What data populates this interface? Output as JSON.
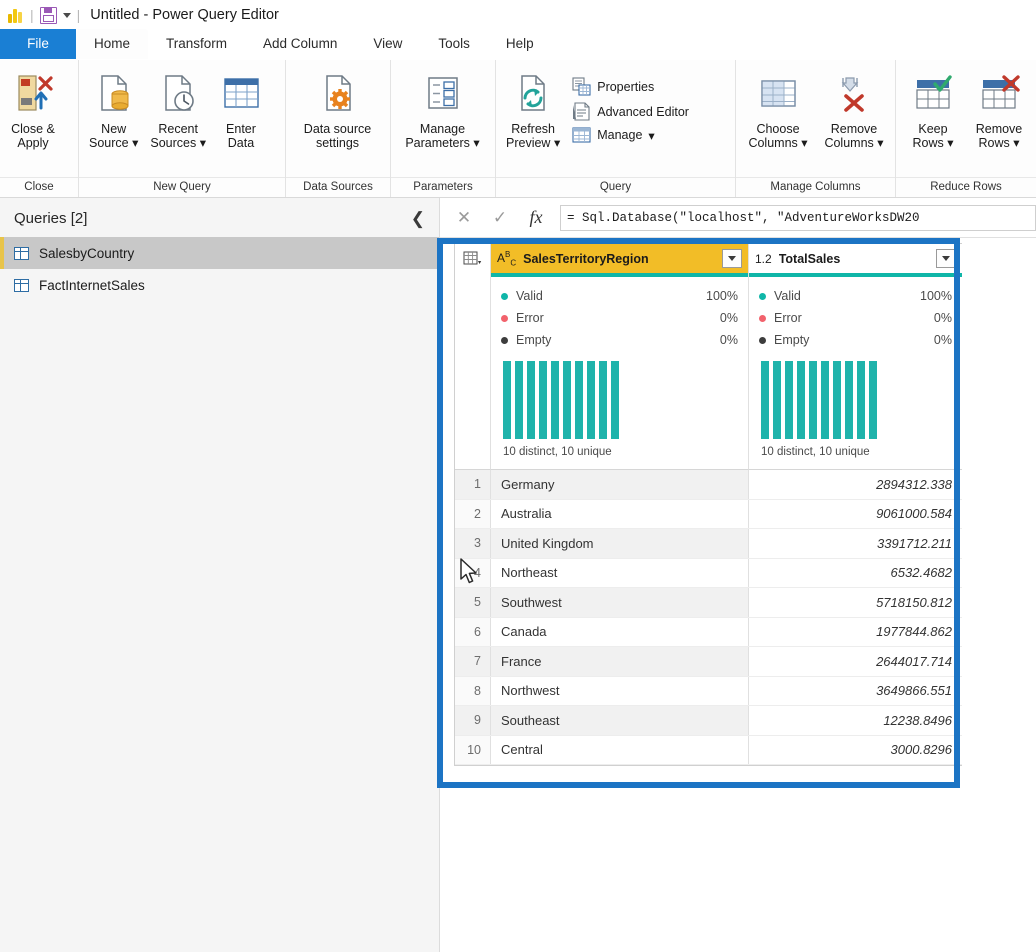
{
  "titlebar": {
    "app_icon": "power-bi-logo",
    "save_icon": "save-icon",
    "quick_access_caret": "chevron-down-icon",
    "title": "Untitled - Power Query Editor"
  },
  "ribbon": {
    "tabs": [
      {
        "label": "File",
        "state": "file"
      },
      {
        "label": "Home",
        "state": "active"
      },
      {
        "label": "Transform",
        "state": "normal"
      },
      {
        "label": "Add Column",
        "state": "normal"
      },
      {
        "label": "View",
        "state": "normal"
      },
      {
        "label": "Tools",
        "state": "normal"
      },
      {
        "label": "Help",
        "state": "normal"
      }
    ],
    "groups": [
      {
        "label": "Close",
        "buttons": [
          {
            "caption": "Close &\nApply",
            "icon": "close-apply-icon",
            "dropdown": true
          }
        ]
      },
      {
        "label": "New Query",
        "buttons": [
          {
            "caption": "New\nSource",
            "icon": "new-source-icon",
            "dropdown": true
          },
          {
            "caption": "Recent\nSources",
            "icon": "recent-sources-icon",
            "dropdown": true
          },
          {
            "caption": "Enter\nData",
            "icon": "enter-data-icon",
            "dropdown": false
          }
        ]
      },
      {
        "label": "Data Sources",
        "buttons": [
          {
            "caption": "Data source\nsettings",
            "icon": "data-source-settings-icon",
            "dropdown": false
          }
        ]
      },
      {
        "label": "Parameters",
        "buttons": [
          {
            "caption": "Manage\nParameters",
            "icon": "manage-parameters-icon",
            "dropdown": true
          }
        ]
      },
      {
        "label": "Query",
        "buttons": [
          {
            "caption": "Refresh\nPreview",
            "icon": "refresh-preview-icon",
            "dropdown": true
          }
        ],
        "small_buttons": [
          {
            "caption": "Properties",
            "icon": "properties-icon",
            "dropdown": false
          },
          {
            "caption": "Advanced Editor",
            "icon": "advanced-editor-icon",
            "dropdown": false
          },
          {
            "caption": "Manage",
            "icon": "manage-icon",
            "dropdown": true
          }
        ]
      },
      {
        "label": "Manage Columns",
        "buttons": [
          {
            "caption": "Choose\nColumns",
            "icon": "choose-columns-icon",
            "dropdown": true
          },
          {
            "caption": "Remove\nColumns",
            "icon": "remove-columns-icon",
            "dropdown": true
          }
        ]
      },
      {
        "label": "Reduce Rows",
        "buttons": [
          {
            "caption": "Keep\nRows",
            "icon": "keep-rows-icon",
            "dropdown": true
          },
          {
            "caption": "Remove\nRows",
            "icon": "remove-rows-icon",
            "dropdown": true
          }
        ]
      }
    ]
  },
  "queries_pane": {
    "title": "Queries [2]",
    "collapse_icon": "chevron-left-icon",
    "items": [
      {
        "label": "SalesbyCountry",
        "selected": true,
        "icon": "table-icon"
      },
      {
        "label": "FactInternetSales",
        "selected": false,
        "icon": "table-icon"
      }
    ]
  },
  "formula_bar": {
    "cancel_icon": "close-icon",
    "confirm_icon": "check-icon",
    "fx_icon": "fx-icon",
    "value": "= Sql.Database(\"localhost\", \"AdventureWorksDW20"
  },
  "grid": {
    "select_all_icon": "select-all-table-icon",
    "columns": [
      {
        "name": "SalesTerritoryRegion",
        "type_icon": "abc-text-type-icon",
        "type_label": "ABC",
        "selected": true,
        "filter_icon": "filter-dropdown-icon",
        "quality": {
          "valid_label": "Valid",
          "valid_value": "100%",
          "error_label": "Error",
          "error_value": "0%",
          "empty_label": "Empty",
          "empty_value": "0%",
          "footer": "10 distinct, 10 unique",
          "histogram": [
            100,
            100,
            100,
            100,
            100,
            100,
            100,
            100,
            100,
            100
          ]
        }
      },
      {
        "name": "TotalSales",
        "type_icon": "decimal-number-type-icon",
        "type_label": "1.2",
        "selected": false,
        "filter_icon": "filter-dropdown-icon",
        "quality": {
          "valid_label": "Valid",
          "valid_value": "100%",
          "error_label": "Error",
          "error_value": "0%",
          "empty_label": "Empty",
          "empty_value": "0%",
          "footer": "10 distinct, 10 unique",
          "histogram": [
            100,
            100,
            100,
            100,
            100,
            100,
            100,
            100,
            100,
            100
          ]
        }
      }
    ],
    "rows": [
      {
        "n": "1",
        "region": "Germany",
        "total": "2894312.338"
      },
      {
        "n": "2",
        "region": "Australia",
        "total": "9061000.584"
      },
      {
        "n": "3",
        "region": "United Kingdom",
        "total": "3391712.211"
      },
      {
        "n": "4",
        "region": "Northeast",
        "total": "6532.4682"
      },
      {
        "n": "5",
        "region": "Southwest",
        "total": "5718150.812"
      },
      {
        "n": "6",
        "region": "Canada",
        "total": "1977844.862"
      },
      {
        "n": "7",
        "region": "France",
        "total": "2644017.714"
      },
      {
        "n": "8",
        "region": "Northwest",
        "total": "3649866.551"
      },
      {
        "n": "9",
        "region": "Southeast",
        "total": "12238.8496"
      },
      {
        "n": "10",
        "region": "Central",
        "total": "3000.8296"
      }
    ]
  },
  "annotation": {
    "color": "#1c74c4",
    "shape": "rectangle-highlight"
  },
  "colors": {
    "file_tab": "#1a7fd4",
    "selected_column_header": "#f2bd27",
    "quality_valid": "#0fb6a8",
    "quality_error": "#f2626c",
    "quality_empty": "#3d3d3d",
    "histogram_bar": "#1fb3ab",
    "query_selected_accent": "#e8c44a"
  }
}
